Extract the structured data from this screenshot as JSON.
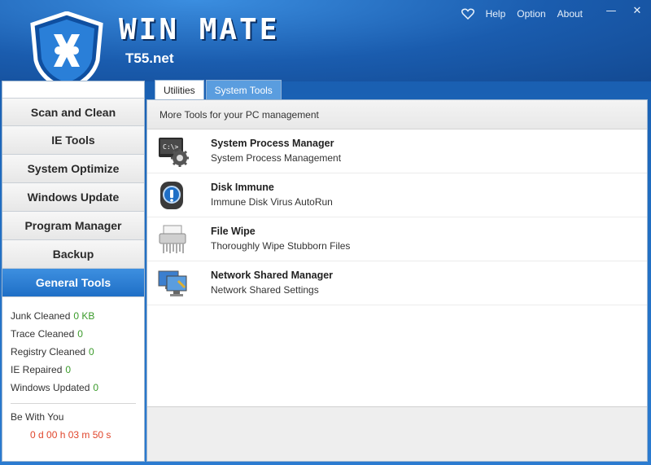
{
  "brand": {
    "title": "WIN MATE",
    "subtitle": "T55.net"
  },
  "topnav": {
    "help": "Help",
    "option": "Option",
    "about": "About"
  },
  "window_controls": {
    "minimize": "—",
    "close": "✕"
  },
  "sidebar": {
    "items": [
      {
        "label": "Scan and Clean"
      },
      {
        "label": "IE Tools"
      },
      {
        "label": "System Optimize"
      },
      {
        "label": "Windows Update"
      },
      {
        "label": "Program Manager"
      },
      {
        "label": "Backup"
      },
      {
        "label": "General Tools"
      }
    ],
    "active_index": 6
  },
  "stats": {
    "junk": {
      "label": "Junk Cleaned",
      "value": "0 KB"
    },
    "trace": {
      "label": "Trace Cleaned",
      "value": "0"
    },
    "registry": {
      "label": "Registry Cleaned",
      "value": "0"
    },
    "ie": {
      "label": "IE Repaired",
      "value": "0"
    },
    "windows": {
      "label": "Windows Updated",
      "value": "0"
    },
    "be_with_you": "Be With You",
    "timer": "0 d 00 h 03 m 50 s"
  },
  "tabs": {
    "utilities": "Utilities",
    "system_tools": "System Tools"
  },
  "content": {
    "header": "More Tools for your PC management",
    "tools": [
      {
        "title": "System Process Manager",
        "desc": "System Process Management",
        "icon": "process-icon"
      },
      {
        "title": "Disk Immune",
        "desc": "Immune Disk Virus AutoRun",
        "icon": "disk-icon"
      },
      {
        "title": "File Wipe",
        "desc": "Thoroughly Wipe Stubborn Files",
        "icon": "shredder-icon"
      },
      {
        "title": "Network Shared Manager",
        "desc": "Network Shared Settings",
        "icon": "network-icon"
      }
    ]
  },
  "colors": {
    "accent": "#1f6fc6",
    "stat_value": "#3a9a2a",
    "timer": "#e0452b"
  }
}
